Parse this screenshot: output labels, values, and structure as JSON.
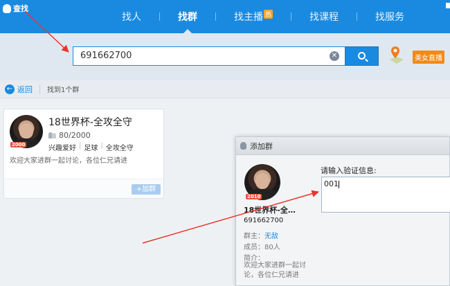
{
  "app": {
    "title": "查找"
  },
  "nav": {
    "tabs": [
      {
        "label": "找人"
      },
      {
        "label": "找群"
      },
      {
        "label": "找主播",
        "badge": "热"
      },
      {
        "label": "找课程"
      },
      {
        "label": "找服务"
      }
    ],
    "active": "找群"
  },
  "search": {
    "value": "691662700",
    "clear_icon": "clear-icon",
    "button_icon": "search-icon"
  },
  "promo": {
    "label": "美女直播",
    "icon": "map-pin-icon"
  },
  "result_bar": {
    "back_label": "返回",
    "summary": "找到1个群"
  },
  "result": {
    "name": "18世界杯-全攻全守",
    "members": "80/2000",
    "tags": [
      "兴趣爱好",
      "足球",
      "全攻全守"
    ],
    "description": "欢迎大家进群一起讨论，各位仁兄请进",
    "level": "2000",
    "join_label": "+加群"
  },
  "dialog": {
    "title": "添加群",
    "group_name": "18世界杯-全…",
    "group_number": "691662700",
    "level": "2010",
    "owner_label": "群主：",
    "owner": "无敌",
    "members_line": "成员：80人",
    "intro_label": "简介：",
    "intro": "欢迎大家进群一起讨论，各位仁兄请进",
    "verify_label": "请输入验证信息:",
    "verify_value": "001"
  },
  "colors": {
    "brand": "#1a8ae0",
    "arrow": "#e8352a",
    "badge": "#f28a14"
  }
}
